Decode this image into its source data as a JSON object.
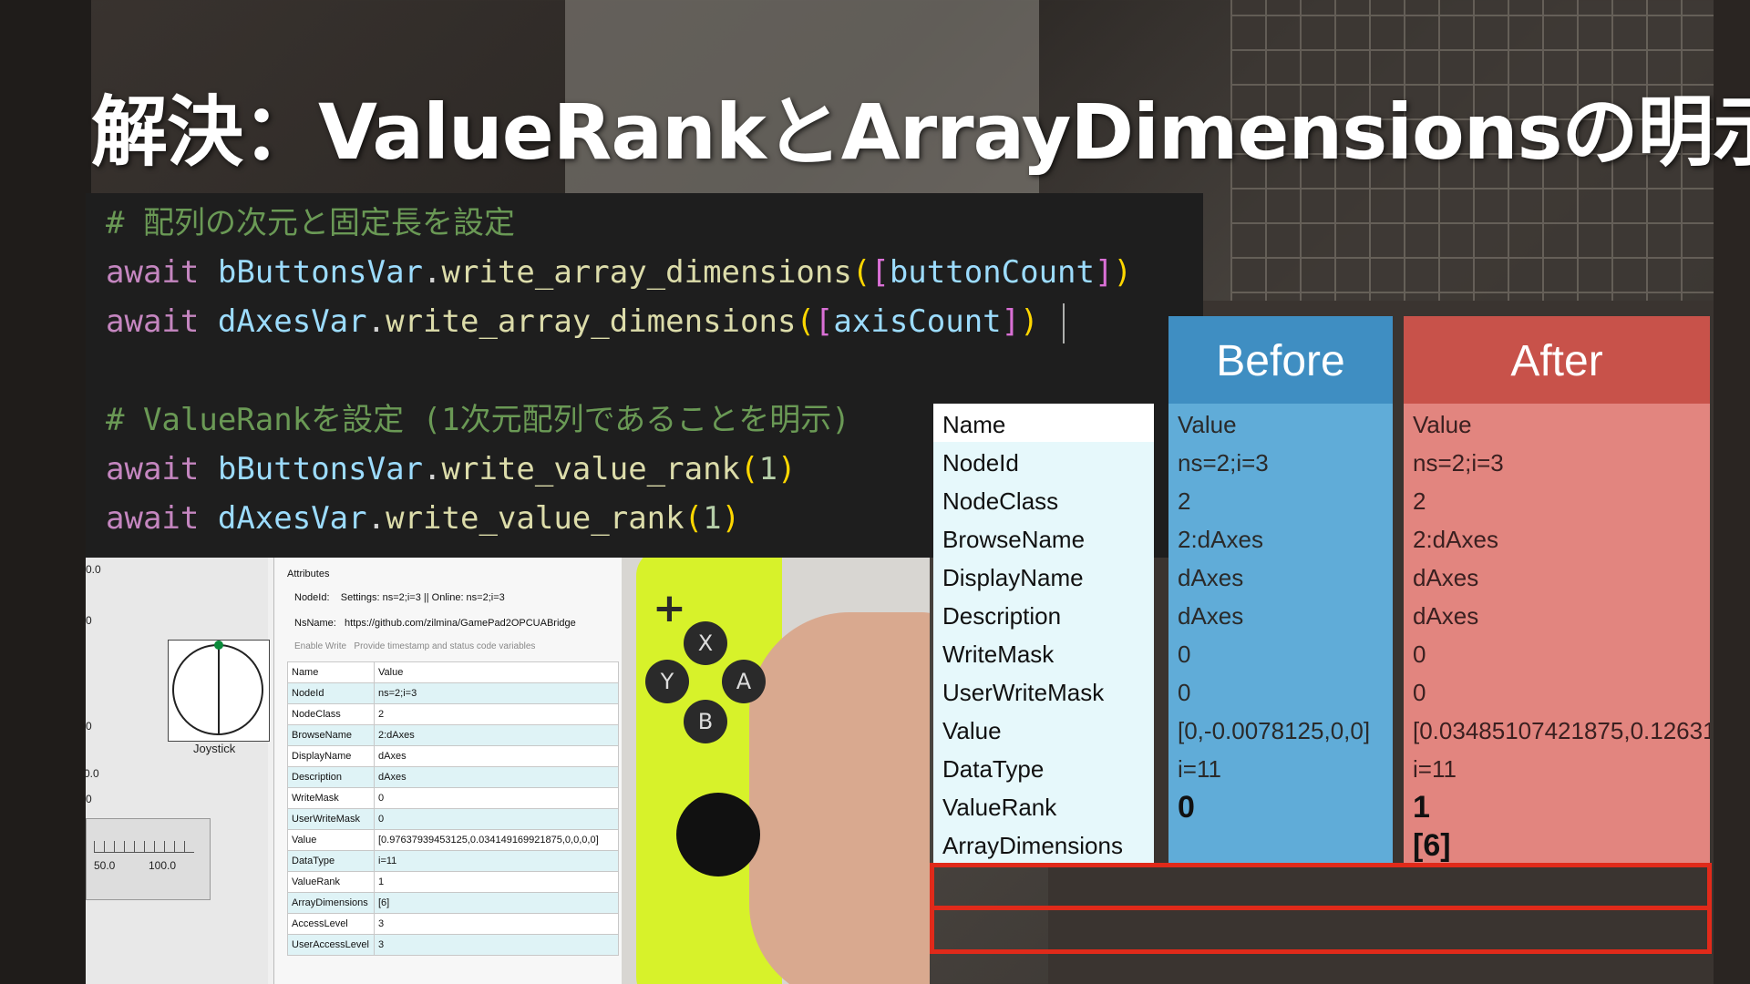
{
  "slide": {
    "title": "解決：ValueRankとArrayDimensionsの明示"
  },
  "code": {
    "comment1": "# 配列の次元と固定長を設定",
    "line1": {
      "kw": "await",
      "obj": "bButtonsVar",
      "method": "write_array_dimensions",
      "arg": "buttonCount"
    },
    "line2": {
      "kw": "await",
      "obj": "dAxesVar",
      "method": "write_array_dimensions",
      "arg": "axisCount"
    },
    "comment2": "# ValueRankを設定 (1次元配列であることを明示)",
    "line3": {
      "kw": "await",
      "obj": "bButtonsVar",
      "method": "write_value_rank",
      "arg": "1"
    },
    "line4": {
      "kw": "await",
      "obj": "dAxesVar",
      "method": "write_value_rank",
      "arg": "1"
    }
  },
  "screenshot": {
    "ticks": [
      "0.0",
      "0",
      "0",
      "0",
      "0.0"
    ],
    "joystick_label": "Joystick",
    "slider_labels": [
      "50.0",
      "100.0"
    ],
    "attributes_header": "Attributes",
    "nodeid_label": "NodeId:",
    "nodeid_value": "Settings: ns=2;i=3 || Online: ns=2;i=3",
    "nsname_label": "NsName:",
    "nsname_value": "https://github.com/zilmina/GamePad2OPCUABridge",
    "enable_write": "Enable Write",
    "provide_ts": "Provide timestamp and status code variables",
    "table": [
      [
        "Name",
        "Value"
      ],
      [
        "NodeId",
        "ns=2;i=3"
      ],
      [
        "NodeClass",
        "2"
      ],
      [
        "BrowseName",
        "2:dAxes"
      ],
      [
        "DisplayName",
        "dAxes"
      ],
      [
        "Description",
        "dAxes"
      ],
      [
        "WriteMask",
        "0"
      ],
      [
        "UserWriteMask",
        "0"
      ],
      [
        "Value",
        "[0.97637939453125,0.034149169921875,0,0,0,0]"
      ],
      [
        "DataType",
        "i=11"
      ],
      [
        "ValueRank",
        "1"
      ],
      [
        "ArrayDimensions",
        "[6]"
      ],
      [
        "AccessLevel",
        "3"
      ],
      [
        "UserAccessLevel",
        "3"
      ]
    ],
    "controller_buttons": [
      "X",
      "Y",
      "A",
      "B"
    ],
    "plus": "+"
  },
  "comparison": {
    "before_header": "Before",
    "after_header": "After",
    "names": [
      "Name",
      "NodeId",
      "NodeClass",
      "BrowseName",
      "DisplayName",
      "Description",
      "WriteMask",
      "UserWriteMask",
      "Value",
      "DataType",
      "ValueRank",
      "ArrayDimensions"
    ],
    "before": [
      "Value",
      "ns=2;i=3",
      "2",
      "2:dAxes",
      "dAxes",
      "dAxes",
      "0",
      "0",
      "[0,-0.0078125,0,0]",
      "i=11",
      "0",
      ""
    ],
    "after": [
      "Value",
      "ns=2;i=3",
      "2",
      "2:dAxes",
      "dAxes",
      "dAxes",
      "0",
      "0",
      "[0.03485107421875,0.12631",
      "i=11",
      "1",
      "[6]"
    ],
    "highlight_color": "#e02a1a",
    "before_color": "#3f8ec2",
    "after_color": "#c8524a"
  }
}
